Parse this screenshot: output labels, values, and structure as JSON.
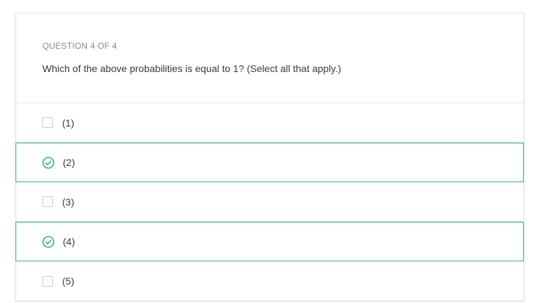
{
  "question": {
    "number_label": "QUESTION 4 OF 4",
    "text": "Which of the above probabilities is equal to 1? (Select all that apply.)"
  },
  "options": [
    {
      "label": "(1)",
      "selected": false
    },
    {
      "label": "(2)",
      "selected": true
    },
    {
      "label": "(3)",
      "selected": false
    },
    {
      "label": "(4)",
      "selected": true
    },
    {
      "label": "(5)",
      "selected": false
    }
  ],
  "colors": {
    "selected_border": "#2eb865",
    "check_icon": "#2eb865",
    "text": "#2e3d49",
    "muted": "#7d8a96"
  },
  "icons": {
    "selected": "check-circle-icon",
    "unselected": "checkbox-empty-icon"
  }
}
